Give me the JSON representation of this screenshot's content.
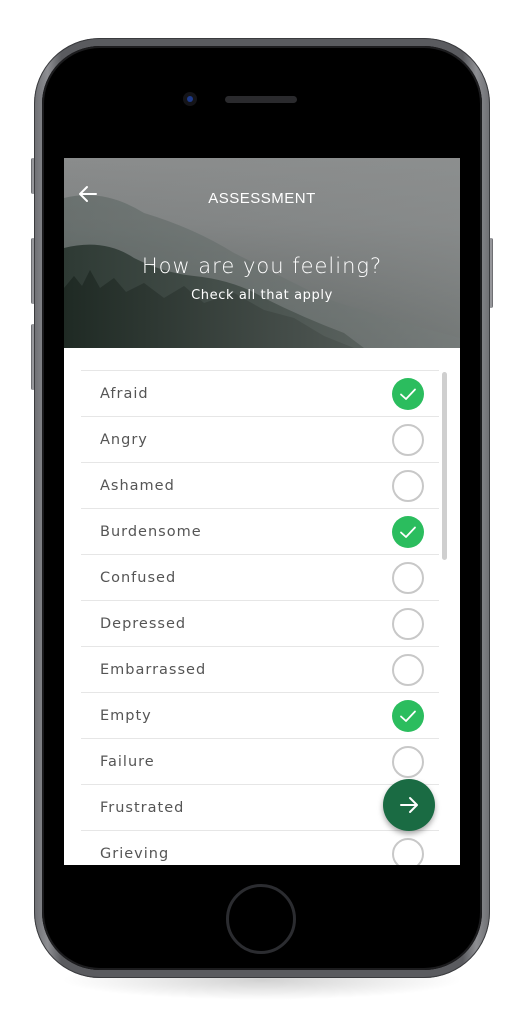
{
  "header": {
    "back_icon": "arrow-left-icon",
    "title": "ASSESSMENT",
    "question": "How are you feeling?",
    "subtitle": "Check all that apply"
  },
  "feelings": [
    {
      "label": "Afraid",
      "checked": true
    },
    {
      "label": "Angry",
      "checked": false
    },
    {
      "label": "Ashamed",
      "checked": false
    },
    {
      "label": "Burdensome",
      "checked": true
    },
    {
      "label": "Confused",
      "checked": false
    },
    {
      "label": "Depressed",
      "checked": false
    },
    {
      "label": "Embarrassed",
      "checked": false
    },
    {
      "label": "Empty",
      "checked": true
    },
    {
      "label": "Failure",
      "checked": false
    },
    {
      "label": "Frustrated",
      "checked": false
    },
    {
      "label": "Grieving",
      "checked": false
    }
  ],
  "next_button": {
    "icon": "arrow-right-icon"
  },
  "colors": {
    "checked": "#2bbd5e",
    "fab": "#1a6b43",
    "unchecked_border": "#c8c8c8",
    "label_text": "#555555"
  }
}
